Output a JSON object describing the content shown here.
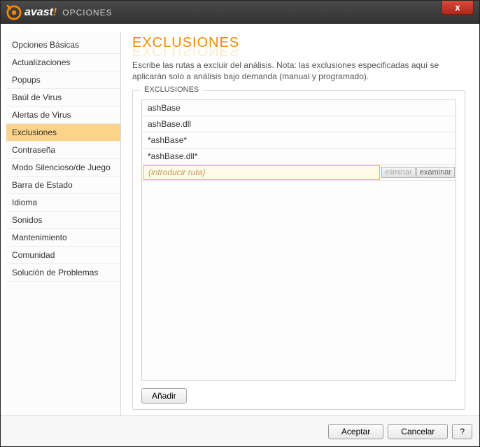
{
  "brand": {
    "name": "avast",
    "exclaim": "!",
    "window_title": "OPCIONES"
  },
  "close": "x",
  "sidebar": {
    "items": [
      {
        "label": "Opciones Básicas"
      },
      {
        "label": "Actualizaciones"
      },
      {
        "label": "Popups"
      },
      {
        "label": "Baúl de Virus"
      },
      {
        "label": "Alertas de Virus"
      },
      {
        "label": "Exclusiones",
        "selected": true
      },
      {
        "label": "Contraseña"
      },
      {
        "label": "Modo Silencioso/de Juego"
      },
      {
        "label": "Barra de Estado"
      },
      {
        "label": "Idioma"
      },
      {
        "label": "Sonidos"
      },
      {
        "label": "Mantenimiento"
      },
      {
        "label": "Comunidad"
      },
      {
        "label": "Solución de Problemas"
      }
    ]
  },
  "page": {
    "title": "EXCLUSIONES",
    "description": "Escribe las rutas a excluir del análisis. Nota: las exclusiones especificadas aquí se aplicarán solo a análisis bajo demanda (manual y programado)."
  },
  "panel": {
    "legend": "EXCLUSIONES",
    "rows": [
      "ashBase",
      "ashBase.dll",
      "*ashBase*",
      "*ashBase.dll*"
    ],
    "input_placeholder": "(introducir ruta)",
    "btn_delete": "eliminar",
    "btn_browse": "examinar",
    "btn_add": "Añadir"
  },
  "footer": {
    "ok": "Aceptar",
    "cancel": "Cancelar",
    "help": "?"
  }
}
